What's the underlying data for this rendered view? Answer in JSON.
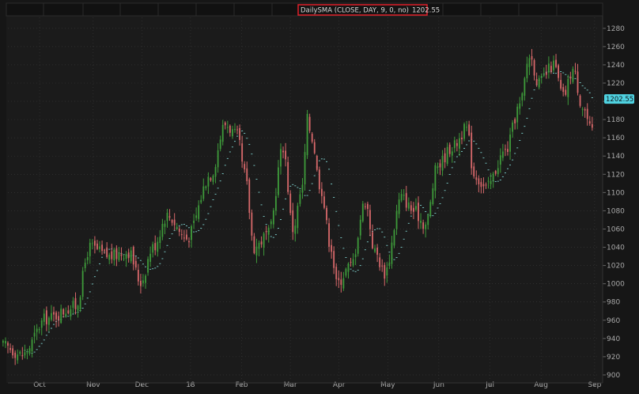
{
  "chart_data": {
    "type": "candlestick",
    "study_label": "DailySMA (CLOSE, DAY, 9, 0, no)",
    "last_value": "1202.55",
    "yticks": [
      900,
      920,
      940,
      960,
      980,
      1000,
      1020,
      1040,
      1060,
      1080,
      1100,
      1120,
      1140,
      1160,
      1180,
      1200,
      1220,
      1240,
      1260,
      1280
    ],
    "ylim": [
      893,
      1292
    ],
    "xlim": [
      0,
      235
    ],
    "months": [
      {
        "label": "Oct",
        "x": 15
      },
      {
        "label": "Nov",
        "x": 37
      },
      {
        "label": "Dec",
        "x": 57
      },
      {
        "label": "18",
        "x": 77
      },
      {
        "label": "Feb",
        "x": 98
      },
      {
        "label": "Mar",
        "x": 118
      },
      {
        "label": "Apr",
        "x": 138
      },
      {
        "label": "May",
        "x": 158
      },
      {
        "label": "Jun",
        "x": 179
      },
      {
        "label": "Jul",
        "x": 200
      },
      {
        "label": "Aug",
        "x": 221
      },
      {
        "label": "Sep",
        "x": 243
      }
    ],
    "anchors": [
      [
        0,
        932
      ],
      [
        8,
        922
      ],
      [
        18,
        962
      ],
      [
        30,
        975
      ],
      [
        36,
        1040
      ],
      [
        44,
        1030
      ],
      [
        52,
        1035
      ],
      [
        57,
        1002
      ],
      [
        62,
        1040
      ],
      [
        68,
        1075
      ],
      [
        76,
        1050
      ],
      [
        86,
        1120
      ],
      [
        92,
        1175
      ],
      [
        97,
        1162
      ],
      [
        100,
        1120
      ],
      [
        104,
        1040
      ],
      [
        110,
        1055
      ],
      [
        116,
        1150
      ],
      [
        120,
        1060
      ],
      [
        124,
        1105
      ],
      [
        126,
        1180
      ],
      [
        128,
        1160
      ],
      [
        131,
        1110
      ],
      [
        136,
        1040
      ],
      [
        138,
        1000
      ],
      [
        144,
        1020
      ],
      [
        150,
        1090
      ],
      [
        154,
        1035
      ],
      [
        158,
        1012
      ],
      [
        165,
        1095
      ],
      [
        170,
        1080
      ],
      [
        175,
        1065
      ],
      [
        180,
        1130
      ],
      [
        186,
        1150
      ],
      [
        192,
        1170
      ],
      [
        195,
        1120
      ],
      [
        200,
        1105
      ],
      [
        208,
        1145
      ],
      [
        214,
        1195
      ],
      [
        218,
        1250
      ],
      [
        222,
        1220
      ],
      [
        228,
        1240
      ],
      [
        232,
        1205
      ],
      [
        236,
        1235
      ],
      [
        240,
        1195
      ],
      [
        244,
        1165
      ]
    ],
    "series": [
      {
        "type": "candlestick",
        "colors": {
          "up": "#3e9a3a",
          "down": "#d6686a"
        }
      },
      {
        "type": "line",
        "style": "dotted",
        "color": "#7fd3d0",
        "period": 9
      }
    ],
    "colors": {
      "background": "#1b1b1b",
      "grid": "#3a3a3a",
      "axis_text": "#a8a8a8",
      "price_tag": "#4fd2e0",
      "label_border": "#e0202a"
    }
  }
}
